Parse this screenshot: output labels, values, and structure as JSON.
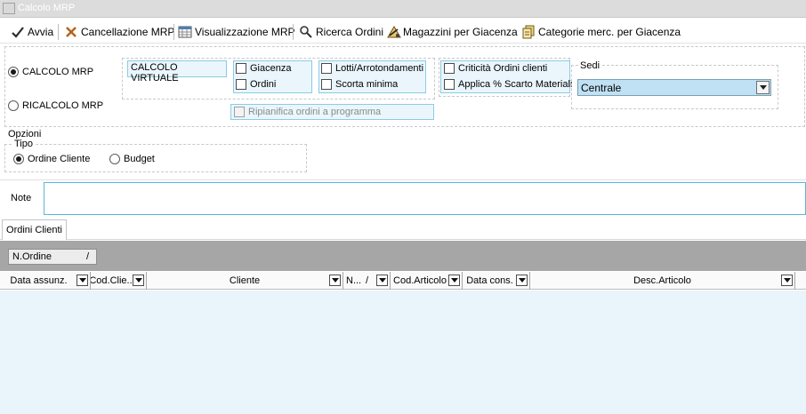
{
  "window": {
    "title": "Calcolo MRP"
  },
  "toolbar": {
    "avvia": "Avvia",
    "cancellazione": "Cancellazione MRP",
    "visualizzazione": "Visualizzazione MRP",
    "ricerca": "Ricerca Ordini",
    "magazzini": "Magazzini per Giacenza",
    "categorie": "Categorie merc. per Giacenza"
  },
  "mode": {
    "calcolo": "CALCOLO MRP",
    "ricalcolo": "RICALCOLO MRP",
    "selected": "calcolo"
  },
  "calcolo_virtuale": "CALCOLO VIRTUALE",
  "checks": {
    "giacenza": "Giacenza",
    "ordini": "Ordini",
    "lotti": "Lotti/Arrotondamenti",
    "scorta": "Scorta minima",
    "criticita": "Criticità Ordini clienti",
    "scarto": "Applica % Scarto Materiali",
    "ripianifica": "Ripianifica ordini a programma"
  },
  "sedi": {
    "label": "Sedi",
    "value": "Centrale"
  },
  "opzioni": {
    "label": "Opzioni",
    "tipo_label": "Tipo",
    "ordine_cliente": "Ordine Cliente",
    "budget": "Budget",
    "selected": "ordine_cliente"
  },
  "note": {
    "label": "Note",
    "value": ""
  },
  "grid": {
    "tab": "Ordini Clienti",
    "group_by": "N.Ordine",
    "group_sort": "/",
    "columns": {
      "data_assunz": "Data assunz.",
      "cod_cliente": "Cod.Clie...",
      "cliente": "Cliente",
      "n": "N...",
      "n_sort": "/",
      "cod_articolo": "Cod.Articolo",
      "data_cons": "Data cons.",
      "desc_articolo": "Desc.Articolo"
    }
  },
  "colors": {
    "grid_band": "#a6a6a6",
    "grid_body": "#e9f4fb",
    "select_bg": "#bfe1f3",
    "accent_border": "#8ccbe6"
  }
}
